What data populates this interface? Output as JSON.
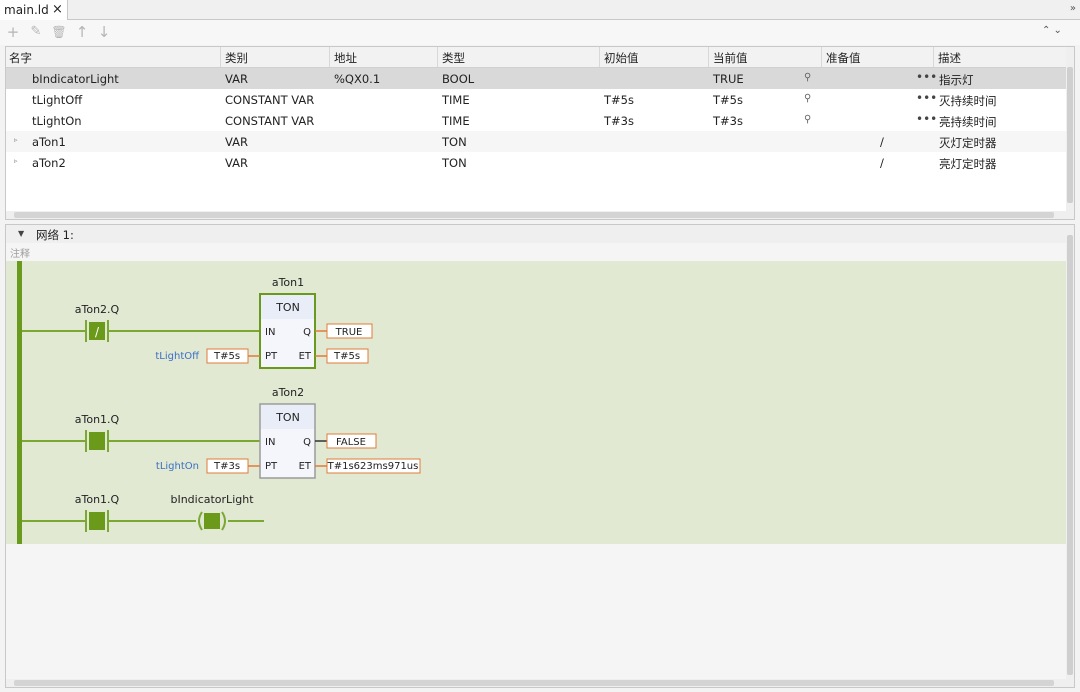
{
  "tab": {
    "label": "main.ld",
    "close": "×"
  },
  "collapse_icon": "»",
  "toolbar": {
    "icons": [
      "add-icon",
      "edit-icon",
      "delete-icon",
      "move-up-icon",
      "move-down-icon"
    ],
    "glyphs": [
      "+",
      "✎",
      "🗑",
      "↑",
      "↓"
    ],
    "right": "⌃  ⌄"
  },
  "table": {
    "headers": [
      "名字",
      "类别",
      "地址",
      "类型",
      "初始值",
      "当前值",
      "准备值",
      "描述"
    ],
    "rows": [
      {
        "name": "bIndicatorLight",
        "kind": "VAR",
        "address": "%QX0.1",
        "type": "BOOL",
        "init": "",
        "current": "TRUE",
        "prepared": "",
        "desc": "指示灯",
        "expand": "",
        "mag": "⚲",
        "dots": "•••"
      },
      {
        "name": "tLightOff",
        "kind": "CONSTANT VAR",
        "address": "",
        "type": "TIME",
        "init": "T#5s",
        "current": "T#5s",
        "prepared": "",
        "desc": "灭持续时间",
        "expand": "",
        "mag": "⚲",
        "dots": "•••"
      },
      {
        "name": "tLightOn",
        "kind": "CONSTANT VAR",
        "address": "",
        "type": "TIME",
        "init": "T#3s",
        "current": "T#3s",
        "prepared": "",
        "desc": "亮持续时间",
        "expand": "",
        "mag": "⚲",
        "dots": "•••"
      },
      {
        "name": "aTon1",
        "kind": "VAR",
        "address": "",
        "type": "TON",
        "init": "",
        "current": "",
        "prepared": "/",
        "desc": "灭灯定时器",
        "expand": "▹",
        "mag": "",
        "dots": ""
      },
      {
        "name": "aTon2",
        "kind": "VAR",
        "address": "",
        "type": "TON",
        "init": "",
        "current": "",
        "prepared": "/",
        "desc": "亮灯定时器",
        "expand": "▹",
        "mag": "",
        "dots": ""
      }
    ]
  },
  "network": {
    "title": "网络 1:",
    "toggle": "▼",
    "comment": "注释",
    "colors": {
      "rail": "#6a9a1d",
      "wire": "#7aa832",
      "active": "#6b9a1a",
      "pin": "#e07b39",
      "var": "#3a6fc4"
    },
    "rungs": [
      {
        "contact_label": "aTon2.Q",
        "contact_glyph": "/",
        "block_instance": "aTon1",
        "block_type": "TON",
        "pin_in": "IN",
        "pin_pt": "PT",
        "pin_q": "Q",
        "pin_et": "ET",
        "pt_var": "tLightOff",
        "pt_value": "T#5s",
        "q_value": "TRUE",
        "et_value": "T#5s"
      },
      {
        "contact_label": "aTon1.Q",
        "contact_glyph": "",
        "block_instance": "aTon2",
        "block_type": "TON",
        "pin_in": "IN",
        "pin_pt": "PT",
        "pin_q": "Q",
        "pin_et": "ET",
        "pt_var": "tLightOn",
        "pt_value": "T#3s",
        "q_value": "FALSE",
        "et_value": "T#1s623ms971us"
      },
      {
        "contact_label": "aTon1.Q",
        "coil_label": "bIndicatorLight"
      }
    ]
  }
}
